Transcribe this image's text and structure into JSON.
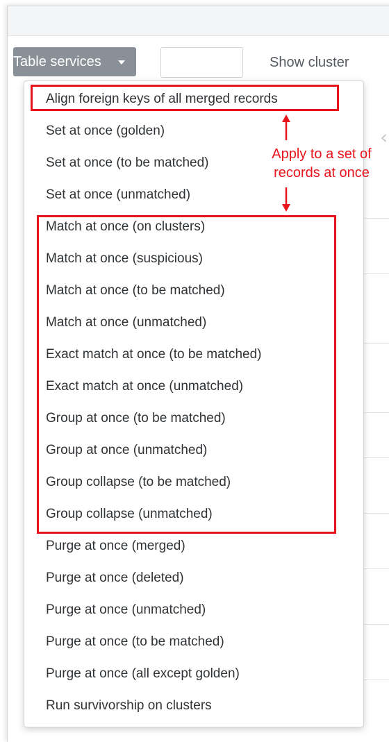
{
  "toolbar": {
    "table_services_label": "Table services",
    "show_cluster_label": "Show cluster"
  },
  "menu": {
    "items": [
      "Align foreign keys of all merged records",
      "Set at once (golden)",
      "Set at once (to be matched)",
      "Set at once (unmatched)",
      "Match at once (on clusters)",
      "Match at once (suspicious)",
      "Match at once (to be matched)",
      "Match at once (unmatched)",
      "Exact match at once (to be matched)",
      "Exact match at once (unmatched)",
      "Group at once (to be matched)",
      "Group at once (unmatched)",
      "Group collapse (to be matched)",
      "Group collapse (unmatched)",
      "Purge at once (merged)",
      "Purge at once (deleted)",
      "Purge at once (unmatched)",
      "Purge at once (to be matched)",
      "Purge at once (all except golden)",
      "Run survivorship on clusters"
    ]
  },
  "annotation": {
    "line1": "Apply to a set of",
    "line2": "records at once",
    "color": "#e8141c"
  },
  "colors": {
    "button_bg": "#8a9097",
    "accent_red": "#e8141c"
  },
  "icons": {
    "caret": "caret-down-icon",
    "chevron": "chevron-left-icon"
  }
}
